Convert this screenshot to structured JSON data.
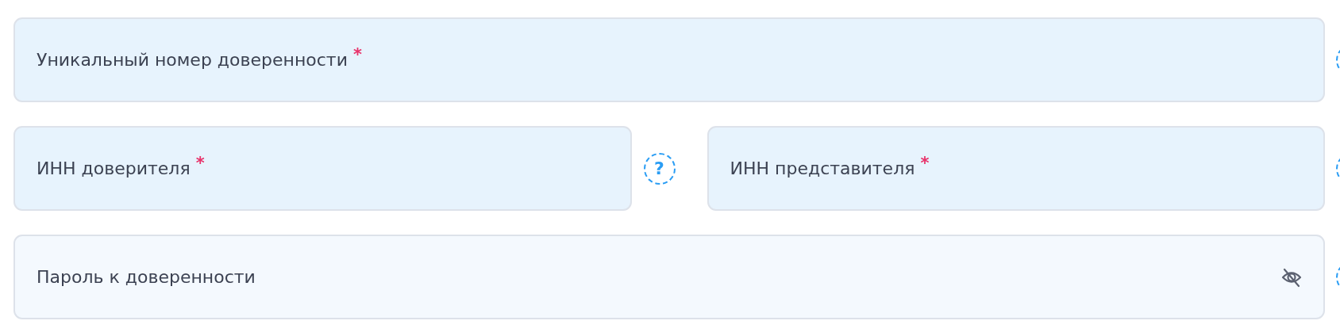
{
  "rows": [
    {
      "fields": [
        {
          "label": "Уникальный номер доверенности",
          "required_mark": "*",
          "kind": "text",
          "help": true
        }
      ]
    },
    {
      "fields": [
        {
          "label": "ИНН доверителя",
          "required_mark": "*",
          "kind": "text",
          "help": true,
          "help_mark": "?"
        },
        {
          "label": "ИНН представителя",
          "required_mark": "*",
          "kind": "text",
          "help": true
        }
      ]
    },
    {
      "fields": [
        {
          "label": "Пароль к доверенности",
          "kind": "password",
          "masked": true,
          "help": true
        }
      ]
    }
  ]
}
